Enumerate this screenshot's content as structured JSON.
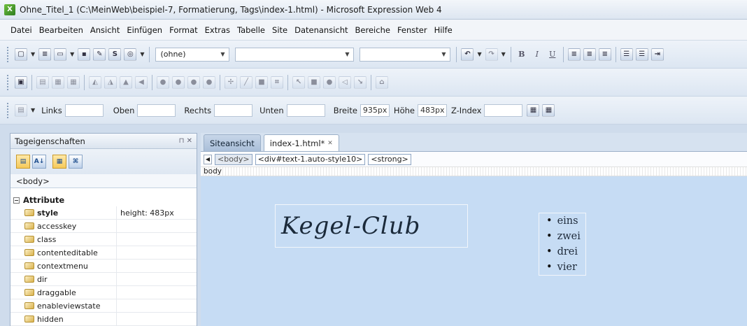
{
  "window": {
    "title": "Ohne_Titel_1 (C:\\MeinWeb\\beispiel-7, Formatierung, Tags\\index-1.html) - Microsoft Expression Web 4"
  },
  "menu": [
    "Datei",
    "Bearbeiten",
    "Ansicht",
    "Einfügen",
    "Format",
    "Extras",
    "Tabelle",
    "Site",
    "Datenansicht",
    "Bereiche",
    "Fenster",
    "Hilfe"
  ],
  "toolbar_common": {
    "style_combo_value": "(ohne)",
    "format_buttons": [
      "B",
      "I",
      "U"
    ]
  },
  "toolbar_position": {
    "labels": {
      "links": "Links",
      "oben": "Oben",
      "rechts": "Rechts",
      "unten": "Unten",
      "breite": "Breite",
      "hoehe": "Höhe",
      "zindex": "Z-Index"
    },
    "values": {
      "breite": "935px",
      "hoehe": "483px"
    }
  },
  "tag_properties_panel": {
    "title": "Tageigenschaften",
    "selected_tag": "<body>",
    "section_header": "Attribute",
    "attributes": [
      {
        "name": "style",
        "value": "height: 483px"
      },
      {
        "name": "accesskey",
        "value": ""
      },
      {
        "name": "class",
        "value": ""
      },
      {
        "name": "contenteditable",
        "value": ""
      },
      {
        "name": "contextmenu",
        "value": ""
      },
      {
        "name": "dir",
        "value": ""
      },
      {
        "name": "draggable",
        "value": ""
      },
      {
        "name": "enableviewstate",
        "value": ""
      },
      {
        "name": "hidden",
        "value": ""
      }
    ]
  },
  "document": {
    "tabs": [
      {
        "label": "Siteansicht"
      },
      {
        "label": "index-1.html*"
      }
    ],
    "breadcrumb": [
      "<body>",
      "<div#text-1.auto-style10>",
      "<strong>"
    ],
    "ruler_label": "body",
    "heading": "Kegel-Club",
    "list_items": [
      "eins",
      "zwei",
      "drei",
      "vier"
    ]
  }
}
